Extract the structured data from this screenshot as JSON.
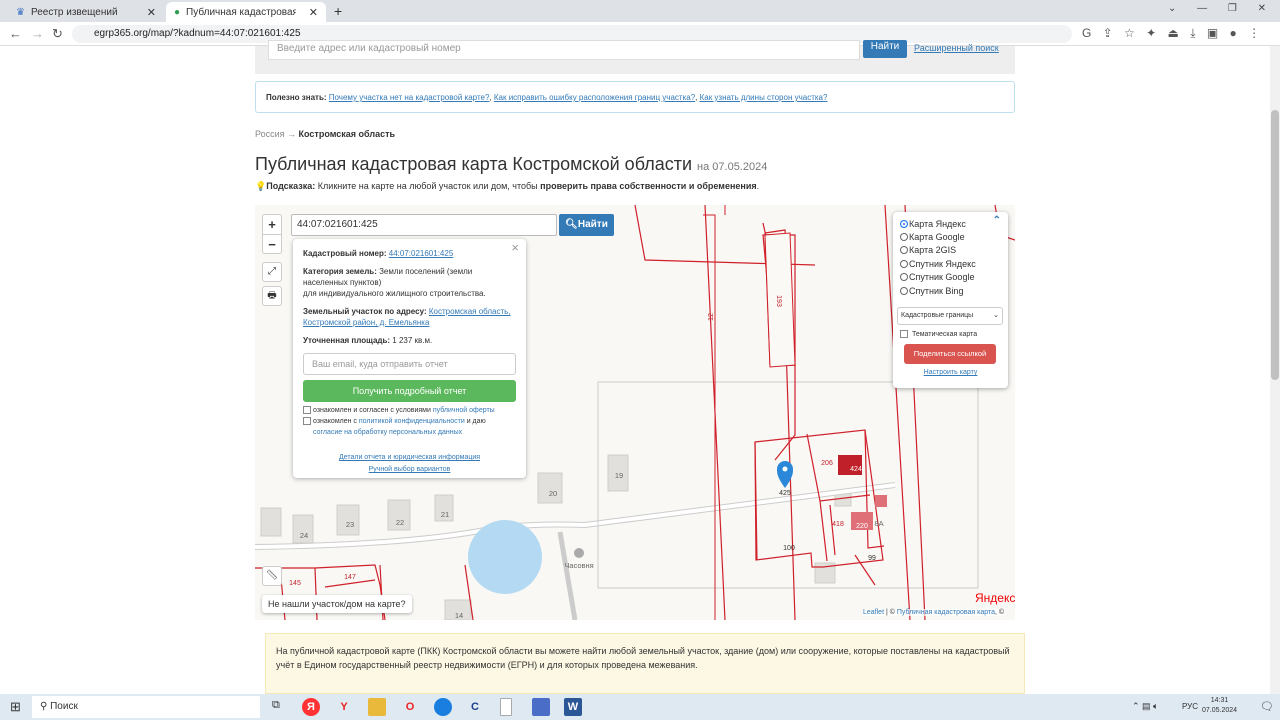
{
  "browser": {
    "tabs": [
      {
        "label": "Реестр извещений",
        "icon": "gov-emblem-icon"
      },
      {
        "label": "Публичная кадастровая карта К",
        "icon": "check-circle-icon",
        "active": true
      }
    ],
    "new_tab": "+",
    "url": "egrp365.org/map/?kadnum=44:07:021601:425"
  },
  "search": {
    "placeholder": "Введите адрес или кадастровый номер",
    "button": "Найти",
    "advanced": "Расширенный поиск"
  },
  "useful": {
    "label": "Полезно знать:",
    "links": [
      "Почему участка нет на кадастровой карте?",
      "Как исправить ошибку расположения границ участка?",
      "Как узнать длины сторон участка?"
    ]
  },
  "breadcrumb": {
    "root": "Россия",
    "arrow": "→",
    "current": "Костромская область"
  },
  "page_title": "Публичная кадастровая карта Костромской области",
  "page_date": "на 07.05.2024",
  "hint": {
    "label": "Подсказка:",
    "text": "Кликните на карте на любой участок или дом, чтобы",
    "bold": "проверить права собственности и обременения",
    "end": "."
  },
  "map": {
    "zoom_in": "+",
    "zoom_out": "−",
    "search_value": "44:07:021601:425",
    "search_button": "Найти",
    "popup": {
      "cad_label": "Кадастровый номер:",
      "cad_value": "44:07:021601:425",
      "cat_label": "Категория земель:",
      "cat_value": "Земли поселений (земли населенных пунктов)",
      "use": "для индивидуального жилищного строительства.",
      "addr_label": "Земельный участок по адресу:",
      "addr_value": "Костромская область, Костромской район, д. Емельянка",
      "area_label": "Уточненная площадь:",
      "area_value": "1 237 кв.м.",
      "email_placeholder": "Ваш email, куда отправить отчет",
      "get_report": "Получить подробный отчет",
      "agree1_text": "ознакомлен и согласен с условиями",
      "agree1_link": "публичной оферты",
      "agree2_text": "ознакомлен с",
      "agree2_link": "политикой конфиденциальности",
      "agree2_mid": "и даю",
      "agree2_link2": "согласие на обработку персональных данных",
      "details": "Детали отчета и юридическая информация",
      "manual": "Ручной выбор вариантов",
      "close": "×"
    },
    "layers": {
      "options": [
        "Карта Яндекс",
        "Карта Google",
        "Карта 2GIS",
        "Спутник Яндекс",
        "Спутник Google",
        "Спутник Bing"
      ],
      "selected": "Карта Яндекс",
      "overlay": "Кадастровые границы",
      "thematic": "Тематическая карта",
      "share": "Поделиться ссылкой",
      "configure": "Настроить карту"
    },
    "not_found": "Не нашли участок/дом на карте?",
    "labels": {
      "p12": "12",
      "p193": "193",
      "p19": "19",
      "p20": "20",
      "p21": "21",
      "p22": "22",
      "p23": "23",
      "p24": "24",
      "p145": "145",
      "p147": "147",
      "p14": "14",
      "chapel": "Часовня",
      "p425": "425",
      "p206": "206",
      "p424": "424",
      "p418": "418",
      "p220": "220",
      "p100": "100",
      "p99": "99",
      "p8a": "8А"
    },
    "attribution": {
      "leaflet": "Leaflet",
      "sep": " | © ",
      "pkk": "Публичная кадастровая карта",
      "end": ", ©",
      "yandex": "Яндекс"
    },
    "colors": {
      "boundary": "#d0202a",
      "water": "#b3daf2",
      "marker": "#2b88d8"
    }
  },
  "info_text": "На публичной кадастровой карте (ПКК) Костромской области вы можете найти любой земельный участок, здание (дом) или сооружение, которые поставлены на кадастровый учёт в Едином государственный реестр недвижимости (ЕГРН) и для которых проведена межевания.",
  "taskbar": {
    "search": "Поиск",
    "lang": "РУС",
    "time": "14:31",
    "date": "07.05.2024"
  }
}
